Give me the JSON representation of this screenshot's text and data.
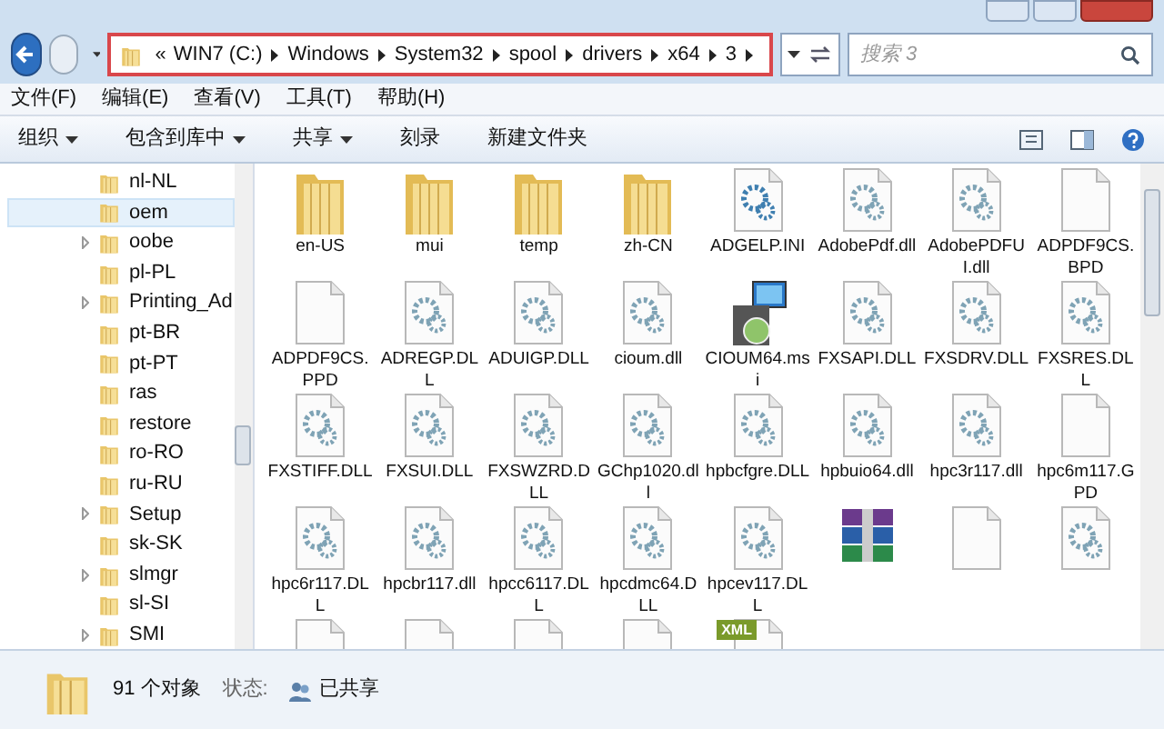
{
  "address_bar": {
    "highlighted": true,
    "overflow": "«",
    "segments": [
      "WIN7 (C:)",
      "Windows",
      "System32",
      "spool",
      "drivers",
      "x64",
      "3"
    ]
  },
  "search": {
    "placeholder": "搜索 3"
  },
  "menu": [
    "文件(F)",
    "编辑(E)",
    "查看(V)",
    "工具(T)",
    "帮助(H)"
  ],
  "toolbar": [
    {
      "label": "组织",
      "dropdown": true
    },
    {
      "label": "包含到库中",
      "dropdown": true
    },
    {
      "label": "共享",
      "dropdown": true
    },
    {
      "label": "刻录",
      "dropdown": false
    },
    {
      "label": "新建文件夹",
      "dropdown": false
    }
  ],
  "tree": [
    {
      "name": "nl-NL",
      "expandable": false,
      "selected": false
    },
    {
      "name": "oem",
      "expandable": false,
      "selected": true
    },
    {
      "name": "oobe",
      "expandable": true,
      "selected": false
    },
    {
      "name": "pl-PL",
      "expandable": false,
      "selected": false
    },
    {
      "name": "Printing_Ad",
      "expandable": true,
      "selected": false
    },
    {
      "name": "pt-BR",
      "expandable": false,
      "selected": false
    },
    {
      "name": "pt-PT",
      "expandable": false,
      "selected": false
    },
    {
      "name": "ras",
      "expandable": false,
      "selected": false
    },
    {
      "name": "restore",
      "expandable": false,
      "selected": false
    },
    {
      "name": "ro-RO",
      "expandable": false,
      "selected": false
    },
    {
      "name": "ru-RU",
      "expandable": false,
      "selected": false
    },
    {
      "name": "Setup",
      "expandable": true,
      "selected": false
    },
    {
      "name": "sk-SK",
      "expandable": false,
      "selected": false
    },
    {
      "name": "slmgr",
      "expandable": true,
      "selected": false
    },
    {
      "name": "sl-SI",
      "expandable": false,
      "selected": false
    },
    {
      "name": "SMI",
      "expandable": true,
      "selected": false
    }
  ],
  "files": [
    {
      "kind": "folder",
      "name": "en-US"
    },
    {
      "kind": "folder",
      "name": "mui"
    },
    {
      "kind": "folder",
      "name": "temp"
    },
    {
      "kind": "folder",
      "name": "zh-CN"
    },
    {
      "kind": "ini",
      "name": "ADGELP.INI"
    },
    {
      "kind": "dll",
      "name": "AdobePdf.dll"
    },
    {
      "kind": "dll",
      "name": "AdobePDFUI.dll"
    },
    {
      "kind": "blank",
      "name": "ADPDF9CS.BPD"
    },
    {
      "kind": "blank",
      "name": "ADPDF9CS.PPD"
    },
    {
      "kind": "dll",
      "name": "ADREGP.DLL"
    },
    {
      "kind": "dll",
      "name": "ADUIGP.DLL"
    },
    {
      "kind": "dll",
      "name": "cioum.dll"
    },
    {
      "kind": "msi",
      "name": "CIOUM64.msi"
    },
    {
      "kind": "dll",
      "name": "FXSAPI.DLL"
    },
    {
      "kind": "dll",
      "name": "FXSDRV.DLL"
    },
    {
      "kind": "dll",
      "name": "FXSRES.DLL"
    },
    {
      "kind": "dll",
      "name": "FXSTIFF.DLL"
    },
    {
      "kind": "dll",
      "name": "FXSUI.DLL"
    },
    {
      "kind": "dll",
      "name": "FXSWZRD.DLL"
    },
    {
      "kind": "dll",
      "name": "GChp1020.dll"
    },
    {
      "kind": "dll",
      "name": "hpbcfgre.DLL"
    },
    {
      "kind": "dll",
      "name": "hpbuio64.dll"
    },
    {
      "kind": "dll",
      "name": "hpc3r117.dll"
    },
    {
      "kind": "blank",
      "name": "hpc6m117.GPD"
    },
    {
      "kind": "dll",
      "name": "hpc6r117.DLL"
    },
    {
      "kind": "dll",
      "name": "hpcbr117.dll"
    },
    {
      "kind": "dll",
      "name": "hpcc6117.DLL"
    },
    {
      "kind": "dll",
      "name": "hpcdmc64.DLL"
    },
    {
      "kind": "dll",
      "name": "hpcev117.DLL"
    },
    {
      "kind": "archive"
    },
    {
      "kind": "blank"
    },
    {
      "kind": "dll"
    },
    {
      "kind": "blank"
    },
    {
      "kind": "blank"
    },
    {
      "kind": "blank"
    },
    {
      "kind": "blank"
    },
    {
      "kind": "xml",
      "badge": "XML"
    }
  ],
  "status_bar": {
    "count": "91 个对象",
    "state_label": "状态:",
    "state": "已共享"
  }
}
